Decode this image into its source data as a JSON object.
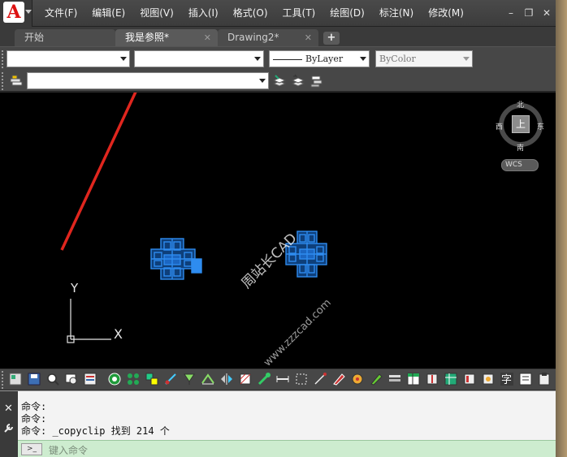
{
  "menu": {
    "items": [
      "文件(F)",
      "编辑(E)",
      "视图(V)",
      "插入(I)",
      "格式(O)",
      "工具(T)",
      "绘图(D)",
      "标注(N)",
      "修改(M)"
    ]
  },
  "window": {
    "minimize": "–",
    "restore": "❐",
    "close": "✕"
  },
  "tabs": {
    "items": [
      {
        "label": "开始",
        "closable": false,
        "active": false
      },
      {
        "label": "我是参照*",
        "closable": true,
        "active": true
      },
      {
        "label": "Drawing2*",
        "closable": true,
        "active": false
      }
    ],
    "close_glyph": "✕",
    "add_label": "+"
  },
  "toolbar": {
    "linetype_value": "ByLayer",
    "color_value": "ByColor"
  },
  "viewcube": {
    "north": "北",
    "south": "南",
    "east": "东",
    "west": "西",
    "face": "上",
    "wcs_label": "WCS"
  },
  "ucs": {
    "x_label": "X",
    "y_label": "Y"
  },
  "watermark": {
    "line1": "周站长CAD",
    "line2": "www.zzzcad.com"
  },
  "command": {
    "history": [
      "命令:",
      "命令:",
      "命令: _copyclip 找到 214 个"
    ],
    "prompt_icon": ">_",
    "input_placeholder": "键入命令"
  },
  "colors": {
    "accent_red": "#e0261e",
    "block_blue": "#2e8cf0",
    "canvas_bg": "#000000"
  }
}
